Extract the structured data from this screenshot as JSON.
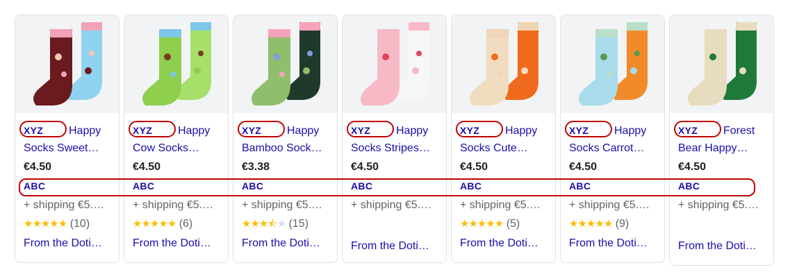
{
  "products": [
    {
      "brand": "XYZ",
      "title_line1": "Happy",
      "title_line2": "Socks Sweet…",
      "price": "€4.50",
      "seller": "ABC",
      "shipping": "+ shipping €5.…",
      "stars": 5,
      "reviews": "(10)",
      "from": "From the Doti…",
      "colors": [
        "#6b1a1f",
        "#8fd3f0",
        "#f2a3b8",
        "#f5c9b0"
      ]
    },
    {
      "brand": "XYZ",
      "title_line1": "Happy",
      "title_line2": "Cow Socks…",
      "price": "€4.50",
      "seller": "ABC",
      "shipping": "+ shipping €5.…",
      "stars": 5,
      "reviews": "(6)",
      "from": "From the Doti…",
      "colors": [
        "#8ecf4e",
        "#a6e06b",
        "#7ec7e8",
        "#7a3a1e"
      ]
    },
    {
      "brand": "XYZ",
      "title_line1": "Happy",
      "title_line2": "Bamboo Sock…",
      "price": "€3.38",
      "seller": "ABC",
      "shipping": "+ shipping €5.…",
      "stars": 3.5,
      "reviews": "(15)",
      "from": "From the Doti…",
      "colors": [
        "#8fbf6a",
        "#1f3a2a",
        "#f5a3b8",
        "#7fa0d8"
      ]
    },
    {
      "brand": "XYZ",
      "title_line1": "Happy",
      "title_line2": "Socks Stripes…",
      "price": "€4.50",
      "seller": "ABC",
      "shipping": "+ shipping €5.…",
      "stars": 0,
      "reviews": "",
      "from": "From the Doti…",
      "colors": [
        "#f7b9c6",
        "#f7f7f7",
        "#f7b9c6",
        "#e0455a"
      ]
    },
    {
      "brand": "XYZ",
      "title_line1": "Happy",
      "title_line2": "Socks Cute…",
      "price": "€4.50",
      "seller": "ABC",
      "shipping": "+ shipping €5.…",
      "stars": 5,
      "reviews": "(5)",
      "from": "From the Doti…",
      "colors": [
        "#f2dcc0",
        "#f06a1e",
        "#eed6b6",
        "#f06a1e"
      ]
    },
    {
      "brand": "XYZ",
      "title_line1": "Happy",
      "title_line2": "Socks Carrot…",
      "price": "€4.50",
      "seller": "ABC",
      "shipping": "+ shipping €5.…",
      "stars": 5,
      "reviews": "(9)",
      "from": "From the Doti…",
      "colors": [
        "#a8dcea",
        "#f28a2a",
        "#b8e0c8",
        "#5a9a4a"
      ]
    },
    {
      "brand": "XYZ",
      "title_line1": "Forest",
      "title_line2": "Bear Happy…",
      "price": "€4.50",
      "seller": "ABC",
      "shipping": "+ shipping €5.…",
      "stars": 0,
      "reviews": "",
      "from": "From the Doti…",
      "colors": [
        "#e8dcc0",
        "#1f7a3a",
        "#e8dcc0",
        "#1f7a3a"
      ]
    }
  ]
}
